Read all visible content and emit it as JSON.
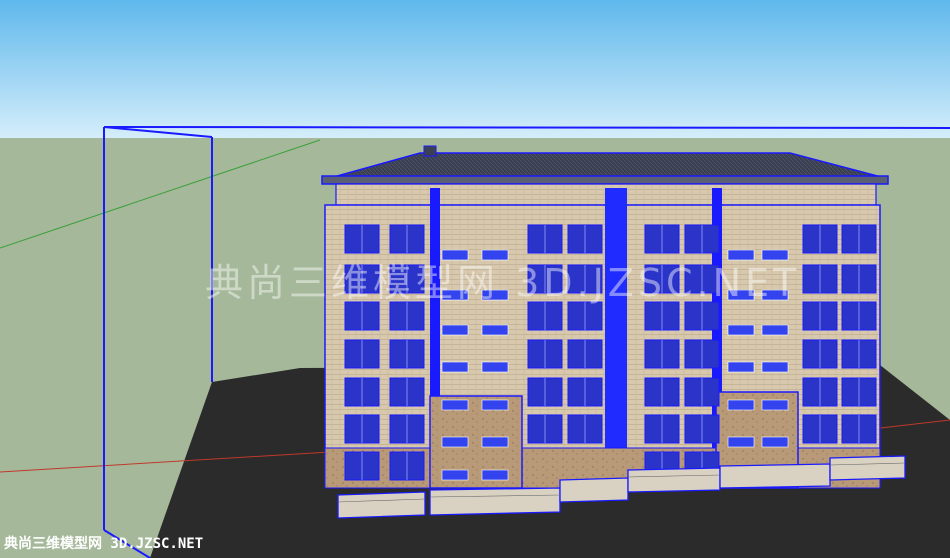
{
  "watermarks": {
    "center": "典尚三维模型网 3D.JZSC.NET",
    "bottom": "典尚三维模型网 3D.JZSC.NET"
  },
  "colors": {
    "sky_top": "#5fb8ec",
    "sky_bottom": "#d6eefa",
    "grass": "#a5b89a",
    "ground": "#2b2b2b",
    "facade": "#d8c9ae",
    "stone": "#b89a78",
    "edge": "#1a1aff",
    "window": "#2a34c8",
    "roof": "#3b3f52"
  }
}
